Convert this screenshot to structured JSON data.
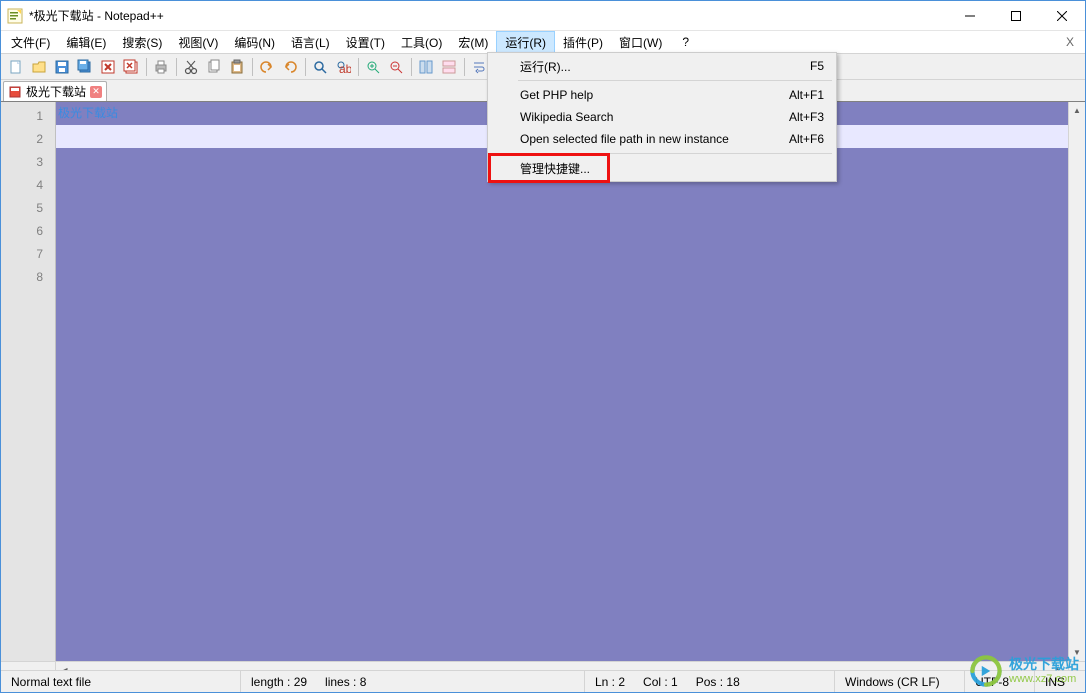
{
  "window": {
    "title": "*极光下载站 - Notepad++"
  },
  "menubar": {
    "items": [
      "文件(F)",
      "编辑(E)",
      "搜索(S)",
      "视图(V)",
      "编码(N)",
      "语言(L)",
      "设置(T)",
      "工具(O)",
      "宏(M)",
      "运行(R)",
      "插件(P)",
      "窗口(W)"
    ],
    "help": "?",
    "active_index": 9
  },
  "tabs": {
    "active": {
      "label": "极光下载站"
    }
  },
  "editor": {
    "line_numbers": [
      "1",
      "2",
      "3",
      "4",
      "5",
      "6",
      "7",
      "8"
    ],
    "lines": [
      "极光下载站",
      "",
      "",
      "",
      "",
      "",
      "",
      ""
    ],
    "selected_line_index": 0,
    "current_line_index": 1
  },
  "dropdown": {
    "items": [
      {
        "label": "运行(R)...",
        "shortcut": "F5"
      },
      {
        "sep": true
      },
      {
        "label": "Get PHP help",
        "shortcut": "Alt+F1"
      },
      {
        "label": "Wikipedia Search",
        "shortcut": "Alt+F3"
      },
      {
        "label": "Open selected file path in new instance",
        "shortcut": "Alt+F6"
      },
      {
        "sep": true
      },
      {
        "label": "管理快捷键...",
        "shortcut": ""
      }
    ]
  },
  "statusbar": {
    "filetype": "Normal text file",
    "length_label": "length : 29",
    "lines_label": "lines : 8",
    "ln_label": "Ln : 2",
    "col_label": "Col : 1",
    "pos_label": "Pos : 18",
    "eol": "Windows (CR LF)",
    "encoding": "UTF-8",
    "mode": "INS"
  },
  "watermark": {
    "line1": "极光下载站",
    "line2": "www.xz7.com"
  }
}
